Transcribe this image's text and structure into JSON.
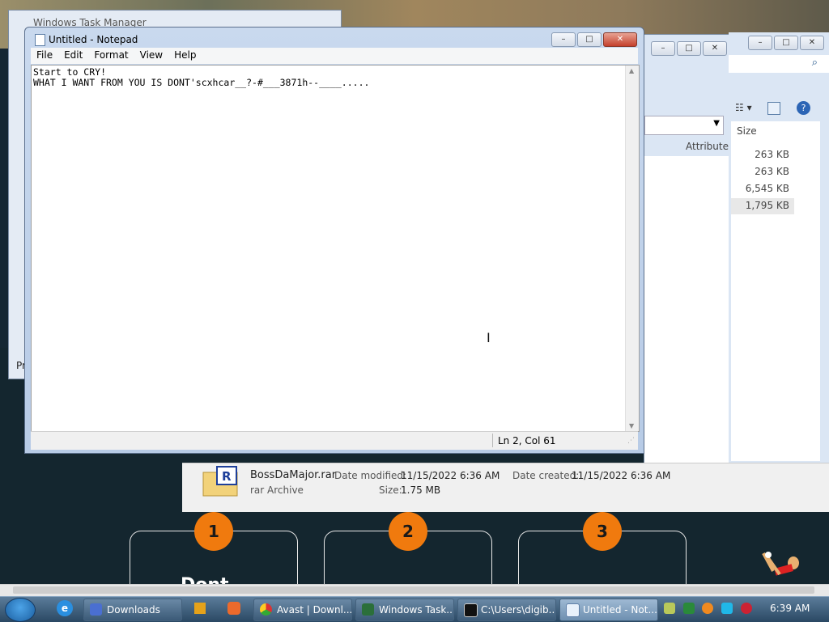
{
  "taskmanager": {
    "title": "Windows Task Manager",
    "status_partial": "Pr"
  },
  "notepad": {
    "title": "Untitled - Notepad",
    "menu": [
      "File",
      "Edit",
      "Format",
      "View",
      "Help"
    ],
    "content": "Start to CRY!\nWHAT I WANT FROM YOU IS DONT'scxhcar__?-#___3871h--____.....",
    "status": "Ln 2, Col 61"
  },
  "explorer": {
    "columns": {
      "size": "Size",
      "attribute": "Attribute"
    },
    "sizes": [
      "263 KB",
      "263 KB",
      "6,545 KB",
      "1,795 KB"
    ]
  },
  "download": {
    "file_name": "BossDaMajor.rar",
    "file_type": "rar Archive",
    "date_modified_label": "Date modified:",
    "date_modified": "11/15/2022 6:36 AM",
    "date_created_label": "Date created:",
    "date_created": "11/15/2022 6:36 AM",
    "size_label": "Size:",
    "size": "1.75 MB"
  },
  "webpage": {
    "steps": [
      "1",
      "2",
      "3"
    ],
    "card_heading_partial": "Dont"
  },
  "taskbar": {
    "items": [
      {
        "label": "Downloads",
        "icon": "folder-icon"
      },
      {
        "label": "Avast | Downl...",
        "icon": "chrome-icon"
      },
      {
        "label": "Windows Task...",
        "icon": "task-manager-icon"
      },
      {
        "label": "C:\\Users\\digib...",
        "icon": "7zip-icon"
      },
      {
        "label": "Untitled - Not...",
        "icon": "notepad-icon"
      }
    ],
    "time": "6:39 AM"
  }
}
